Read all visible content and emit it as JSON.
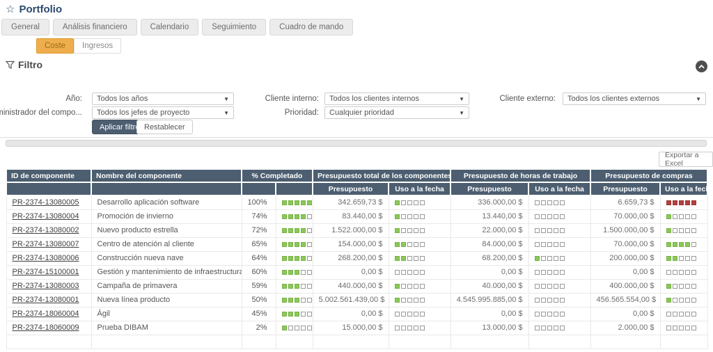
{
  "page": {
    "title": "Portfolio"
  },
  "tabs": [
    {
      "label": "General"
    },
    {
      "label": "Análisis financiero"
    },
    {
      "label": "Calendario"
    },
    {
      "label": "Seguimiento"
    },
    {
      "label": "Cuadro de mando"
    }
  ],
  "subtabs": [
    {
      "label": "Coste",
      "active": true
    },
    {
      "label": "Ingresos",
      "active": false
    }
  ],
  "filter": {
    "heading": "Filtro",
    "fields": [
      {
        "label": "Año:",
        "value": "Todos los años"
      },
      {
        "label": "Administrador del compo...",
        "value": "Todos los jefes de proyecto"
      },
      {
        "label": "Cliente interno:",
        "value": "Todos los clientes internos"
      },
      {
        "label": "Prioridad:",
        "value": "Cualquier prioridad"
      },
      {
        "label": "Cliente externo:",
        "value": "Todos los clientes externos"
      }
    ],
    "apply_label": "Aplicar filtro",
    "reset_label": "Restablecer"
  },
  "toolbar": {
    "export_label": "Exportar a Excel"
  },
  "colors": {
    "header_bg": "#4c5e70",
    "accent_amber": "#efae4d",
    "square_green": "#8cc859",
    "square_red": "#b5403e",
    "title_navy": "#28496e"
  },
  "table": {
    "headers": {
      "id": "ID de componente",
      "name": "Nombre del componente",
      "pct": "% Completado",
      "group_total": "Presupuesto total de los componentes",
      "group_hours": "Presupuesto de horas de trabajo",
      "group_purchases": "Presupuesto de compras",
      "sub_budget": "Presupuesto",
      "sub_used": "Uso a la fecha"
    },
    "rows": [
      {
        "id": "PR-2374-13080005",
        "name": "Desarrollo aplicación software",
        "pct": "100%",
        "pct_sq": 5,
        "total_budget": "342.659,73 $",
        "total_used": 1,
        "total_used_color": "green",
        "hours_budget": "336.000,00 $",
        "hours_used": 0,
        "hours_used_color": "green",
        "purch_budget": "6.659,73 $",
        "purch_used": 5,
        "purch_used_color": "red"
      },
      {
        "id": "PR-2374-13080004",
        "name": "Promoción de invierno",
        "pct": "74%",
        "pct_sq": 4,
        "total_budget": "83.440,00 $",
        "total_used": 1,
        "total_used_color": "green",
        "hours_budget": "13.440,00 $",
        "hours_used": 0,
        "hours_used_color": "green",
        "purch_budget": "70.000,00 $",
        "purch_used": 1,
        "purch_used_color": "green"
      },
      {
        "id": "PR-2374-13080002",
        "name": "Nuevo producto estrella",
        "pct": "72%",
        "pct_sq": 4,
        "total_budget": "1.522.000,00 $",
        "total_used": 1,
        "total_used_color": "green",
        "hours_budget": "22.000,00 $",
        "hours_used": 0,
        "hours_used_color": "green",
        "purch_budget": "1.500.000,00 $",
        "purch_used": 1,
        "purch_used_color": "green"
      },
      {
        "id": "PR-2374-13080007",
        "name": "Centro de atención al cliente",
        "pct": "65%",
        "pct_sq": 4,
        "total_budget": "154.000,00 $",
        "total_used": 2,
        "total_used_color": "green",
        "hours_budget": "84.000,00 $",
        "hours_used": 0,
        "hours_used_color": "green",
        "purch_budget": "70.000,00 $",
        "purch_used": 4,
        "purch_used_color": "green"
      },
      {
        "id": "PR-2374-13080006",
        "name": "Construcción nueva nave",
        "pct": "64%",
        "pct_sq": 4,
        "total_budget": "268.200,00 $",
        "total_used": 2,
        "total_used_color": "green",
        "hours_budget": "68.200,00 $",
        "hours_used": 1,
        "hours_used_color": "green",
        "purch_budget": "200.000,00 $",
        "purch_used": 2,
        "purch_used_color": "green"
      },
      {
        "id": "PR-2374-15100001",
        "name": "Gestión y mantenimiento de infraestructura",
        "pct": "60%",
        "pct_sq": 3,
        "total_budget": "0,00 $",
        "total_used": 0,
        "total_used_color": "green",
        "hours_budget": "0,00 $",
        "hours_used": 0,
        "hours_used_color": "green",
        "purch_budget": "0,00 $",
        "purch_used": 0,
        "purch_used_color": "green"
      },
      {
        "id": "PR-2374-13080003",
        "name": "Campaña de primavera",
        "pct": "59%",
        "pct_sq": 3,
        "total_budget": "440.000,00 $",
        "total_used": 1,
        "total_used_color": "green",
        "hours_budget": "40.000,00 $",
        "hours_used": 0,
        "hours_used_color": "green",
        "purch_budget": "400.000,00 $",
        "purch_used": 1,
        "purch_used_color": "green"
      },
      {
        "id": "PR-2374-13080001",
        "name": "Nueva línea producto",
        "pct": "50%",
        "pct_sq": 3,
        "total_budget": "5.002.561.439,00 $",
        "total_used": 1,
        "total_used_color": "green",
        "hours_budget": "4.545.995.885,00 $",
        "hours_used": 0,
        "hours_used_color": "green",
        "purch_budget": "456.565.554,00 $",
        "purch_used": 1,
        "purch_used_color": "green"
      },
      {
        "id": "PR-2374-18060004",
        "name": "Ágil",
        "pct": "45%",
        "pct_sq": 3,
        "total_budget": "0,00 $",
        "total_used": 0,
        "total_used_color": "green",
        "hours_budget": "0,00 $",
        "hours_used": 0,
        "hours_used_color": "green",
        "purch_budget": "0,00 $",
        "purch_used": 0,
        "purch_used_color": "green"
      },
      {
        "id": "PR-2374-18060009",
        "name": "Prueba DIBAM",
        "pct": "2%",
        "pct_sq": 1,
        "total_budget": "15.000,00 $",
        "total_used": 0,
        "total_used_color": "green",
        "hours_budget": "13.000,00 $",
        "hours_used": 0,
        "hours_used_color": "green",
        "purch_budget": "2.000,00 $",
        "purch_used": 0,
        "purch_used_color": "green"
      }
    ]
  }
}
